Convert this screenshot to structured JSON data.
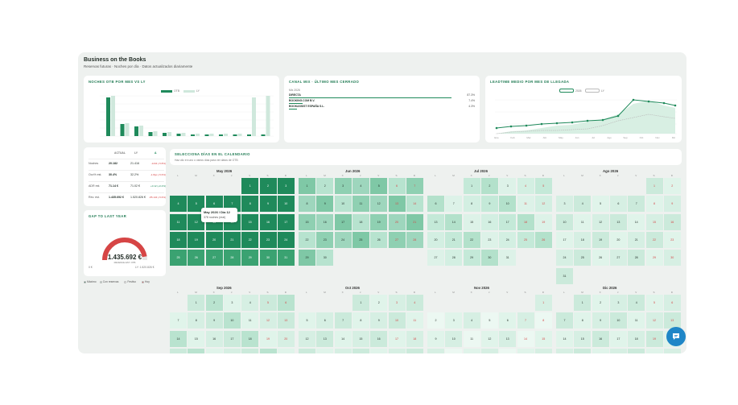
{
  "header": {
    "title": "Business on the Books",
    "subtitle": "Reservas futuras · Noches por día · Datos actualizados diariamente"
  },
  "noches_card": {
    "title": "Noches OTB por mes vs LY",
    "legend": [
      "OTB",
      "LY"
    ],
    "colors": {
      "otb": "#1f8a5b",
      "ly": "#cfe8dc"
    }
  },
  "canal_card": {
    "title": "Canal mix · último mes cerrado",
    "header_label": "Mix 2026",
    "rows": [
      {
        "label": "DIRECTA",
        "value": "87.3%",
        "share": 0.873
      },
      {
        "label": "BOOKING.COM B.V.",
        "value": "7.4%",
        "share": 0.074
      },
      {
        "label": "BOOKASSIST ESPAÑA S.L.",
        "value": "4.3%",
        "share": 0.043
      }
    ]
  },
  "leadtime_card": {
    "title": "Leadtime medio por mes de llegada",
    "legend": [
      "2026",
      "LY"
    ],
    "x_labels": [
      "Ene",
      "Feb",
      "Mar",
      "Abr",
      "May",
      "Jun",
      "Jul",
      "Ago",
      "Sep",
      "Oct",
      "Nov",
      "Dic"
    ]
  },
  "kpi_table": {
    "columns": [
      "ACTUAL",
      "LY",
      "Δ"
    ],
    "rows": [
      {
        "label": "Noches",
        "actual": "20.182",
        "ly": "21.416",
        "delta": "-1234 (-5.8%)",
        "delta_color": "#d64545"
      },
      {
        "label": "Occ% est.",
        "actual": "30.4%",
        "ly": "32.2%",
        "delta": "-1.8pp (-5.6%)",
        "delta_color": "#d64545"
      },
      {
        "label": "ADR est.",
        "actual": "71.14 €",
        "ly": "71.02 €",
        "delta": "+0.12 (+0.2%)",
        "delta_color": "#1f8a5b"
      },
      {
        "label": "Rev. est.",
        "actual": "1.435.692 €",
        "ly": "1.520.826 €",
        "delta": "-85.134 (-5.6%)",
        "delta_color": "#d64545"
      }
    ]
  },
  "gap_card": {
    "title": "Gap to last year",
    "value": "1.435.692 €",
    "sub": "REVENUE EST. OTB",
    "min_label": "0 €",
    "max_label": "LY: 1.520.826 €",
    "fill_fraction": 0.944
  },
  "legend": [
    {
      "label": "Máximo",
      "color": "#1f6e4c"
    },
    {
      "label": "Con reservas",
      "color": "#b7e3cf"
    },
    {
      "label": "Festivo",
      "color": "#ffffff"
    },
    {
      "label": "Hoy",
      "color": "#d64545"
    }
  ],
  "calendar": {
    "title": "Selecciona días en el calendario",
    "hint": "Haz clic en uno o varios días para ver datos de OTB",
    "dow": [
      "L",
      "M",
      "X",
      "J",
      "V",
      "S",
      "D"
    ],
    "months": [
      {
        "name": "May 2026",
        "offset": 4,
        "days": 31
      },
      {
        "name": "Jun 2026",
        "offset": 0,
        "days": 30
      },
      {
        "name": "Jul 2026",
        "offset": 2,
        "days": 31
      },
      {
        "name": "Ago 2026",
        "offset": 5,
        "days": 31
      },
      {
        "name": "Sep 2026",
        "offset": 1,
        "days": 30
      },
      {
        "name": "Oct 2026",
        "offset": 3,
        "days": 31
      },
      {
        "name": "Nov 2026",
        "offset": 6,
        "days": 30
      },
      {
        "name": "Dic 2026",
        "offset": 1,
        "days": 31
      }
    ]
  },
  "tooltip": {
    "line1": "May 2026 / Día 12",
    "line2": "378 noches (real)"
  }
}
